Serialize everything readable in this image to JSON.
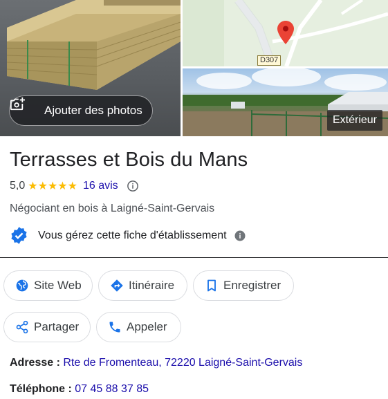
{
  "photos": {
    "add_button_label": "Ajouter des photos",
    "exterior_label": "Extérieur",
    "map_road_label": "D307"
  },
  "business": {
    "name": "Terrasses et Bois du Mans",
    "rating": "5,0",
    "stars": "★★★★★",
    "reviews_link": "16 avis",
    "category": "Négociant en bois à Laigné-Saint-Gervais",
    "manage_text": "Vous gérez cette fiche d'établissement"
  },
  "actions": {
    "website": "Site Web",
    "directions": "Itinéraire",
    "save": "Enregistrer",
    "share": "Partager",
    "call": "Appeler"
  },
  "details": {
    "address_label": "Adresse :",
    "address_value": "Rte de Fromenteau, 72220 Laigné-Saint-Gervais",
    "phone_label": "Téléphone :",
    "phone_value": "07 45 88 37 85"
  },
  "colors": {
    "link": "#1a0dab",
    "star": "#fbbc04",
    "verified_blue": "#1a73e8",
    "map_pin": "#ea4335"
  }
}
